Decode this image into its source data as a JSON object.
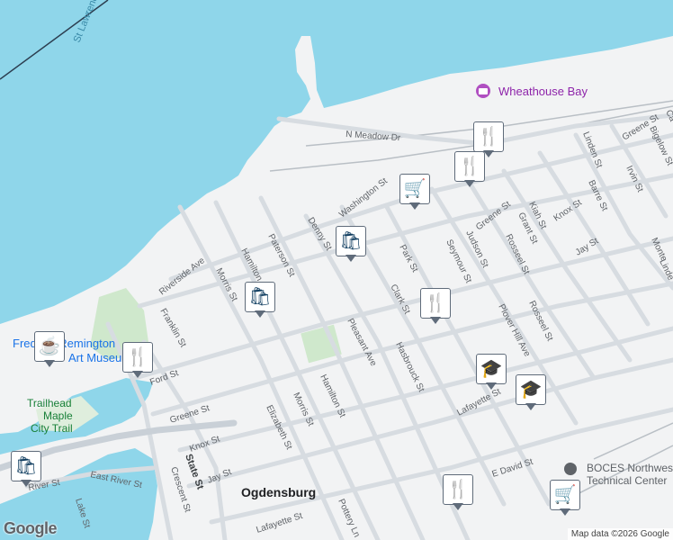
{
  "map": {
    "water_label": "St Lawrence",
    "city_label": "Ogdensburg",
    "colors": {
      "water": "#8fd6ea",
      "land": "#f2f3f4",
      "park": "#cfe8cc",
      "road": "#d7dce1",
      "marker_icon": "#0d3b5e"
    },
    "streets": {
      "n_meadow": "N Meadow Dr",
      "washington": "Washington St",
      "denny": "Denny St",
      "paterson": "Paterson St",
      "hamilton_top": "Hamilton St",
      "morris_top": "Morris St",
      "riverside": "Riverside Ave",
      "franklin": "Franklin St",
      "ford": "Ford St",
      "greene_left": "Greene St",
      "knox_left": "Knox St",
      "jay_left": "Jay St",
      "state": "State St",
      "crescent": "Crescent St",
      "east_river": "East River St",
      "river": "River St",
      "lake": "Lake St",
      "elizabeth": "Elizabeth St",
      "morris_bottom": "Morris St",
      "hamilton_bottom": "Hamilton St",
      "pleasant": "Pleasant Ave",
      "pottery": "Pottery Ln",
      "lafayette_bottom": "Lafayette St",
      "clark": "Clark St",
      "park": "Park St",
      "seymour": "Seymour St",
      "judson": "Judson St",
      "rosseel_top": "Rosseel St",
      "greene_right": "Greene St",
      "kiah": "Kiah St",
      "grant": "Grant St",
      "knox_right": "Knox St",
      "barre": "Barre St",
      "irvin": "Irvin St",
      "linden": "Linden St",
      "greene_far": "Greene St",
      "bigelow": "Bigelow St",
      "jay_right": "Jay St",
      "plover_hill": "Plover Hill Ave",
      "rosseel_bottom": "Rosseel St",
      "hasbrouck": "Hasbrouck St",
      "lafayette_right": "Lafayette St",
      "e_david": "E David St",
      "monte": "Monte",
      "linde": "Linde",
      "ca": "Ca"
    },
    "pois": {
      "wheathouse_bay": "Wheathouse Bay",
      "frederic_line1": "Frederic Remington",
      "frederic_line2": "Art Museum",
      "trailhead_line1": "Trailhead",
      "trailhead_line2": "Maple",
      "trailhead_line3": "City Trail",
      "boces_line1": "BOCES Northwest",
      "boces_line2": "Technical Center"
    }
  },
  "markers": [
    {
      "name": "restaurant-marker-1",
      "icon": "restaurant-icon",
      "glyph": "🍴"
    },
    {
      "name": "restaurant-marker-2",
      "icon": "restaurant-icon",
      "glyph": "🍴"
    },
    {
      "name": "shopping-cart-marker-1",
      "icon": "shopping-cart-icon",
      "glyph": "🛒"
    },
    {
      "name": "shopping-bag-marker-1",
      "icon": "shopping-bag-icon",
      "glyph": "🛍"
    },
    {
      "name": "shopping-bag-marker-2",
      "icon": "shopping-bag-icon",
      "glyph": "🛍"
    },
    {
      "name": "restaurant-marker-3",
      "icon": "restaurant-icon",
      "glyph": "🍴"
    },
    {
      "name": "cafe-marker",
      "icon": "coffee-cup-icon",
      "glyph": "☕"
    },
    {
      "name": "restaurant-marker-4",
      "icon": "restaurant-icon",
      "glyph": "🍴"
    },
    {
      "name": "school-marker-1",
      "icon": "graduation-cap-icon",
      "glyph": "🎓"
    },
    {
      "name": "school-marker-2",
      "icon": "graduation-cap-icon",
      "glyph": "🎓"
    },
    {
      "name": "shopping-bag-marker-3",
      "icon": "shopping-bag-icon",
      "glyph": "🛍"
    },
    {
      "name": "restaurant-marker-5",
      "icon": "restaurant-icon",
      "glyph": "🍴"
    },
    {
      "name": "shopping-cart-marker-2",
      "icon": "shopping-cart-icon",
      "glyph": "🛒"
    }
  ],
  "footer": {
    "logo": "Google",
    "attribution": "Map data ©2026 Google"
  }
}
